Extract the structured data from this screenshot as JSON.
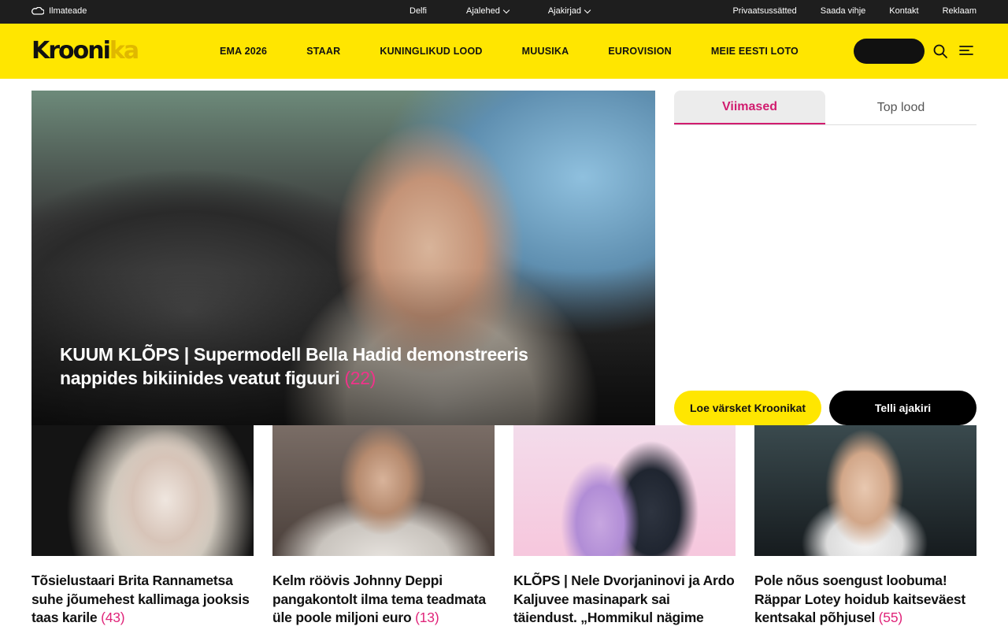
{
  "topbar": {
    "weather_label": "Ilmateade",
    "links_center": [
      {
        "label": "Delfi",
        "dropdown": false
      },
      {
        "label": "Ajalehed",
        "dropdown": true
      },
      {
        "label": "Ajakirjad",
        "dropdown": true
      }
    ],
    "links_right": [
      "Privaatsussätted",
      "Saada vihje",
      "Kontakt",
      "Reklaam"
    ]
  },
  "header": {
    "logo_main": "Kroonika",
    "nav": [
      "EMA 2026",
      "STAAR",
      "KUNINGLIKUD LOOD",
      "MUUSIKA",
      "EUROVISION",
      "MEIE EESTI LOTO"
    ]
  },
  "hero": {
    "title": "KUUM KLÕPS | Supermodell Bella Hadid demonstreeris nappides bikiinides veatut figuuri",
    "comments": "(22)"
  },
  "sidebar": {
    "tabs": [
      "Viimased",
      "Top lood"
    ],
    "active_tab": "Viimased",
    "button_read": "Loe värsket Kroonikat",
    "button_order": "Telli ajakiri"
  },
  "articles": [
    {
      "title": "Tõsielustaari Brita Rannametsa suhe jõumehest kallimaga jooksis taas karile",
      "comments": "(43)"
    },
    {
      "title": "Kelm röövis Johnny Deppi pangakontolt ilma tema teadmata üle poole miljoni euro",
      "comments": "(13)"
    },
    {
      "title": "KLÕPS | Nele Dvorjaninovi ja Ardo Kaljuvee masinapark sai täiendust. „Hommikul nägime",
      "comments": ""
    },
    {
      "title": "Pole nõus soengust loobuma! Räppar Lotey hoidub kaitseväest kentsakal põhjusel",
      "comments": "(55)"
    }
  ],
  "colors": {
    "brand_yellow": "#ffe600",
    "accent_pink": "#d11c6f",
    "topbar_bg": "#1e1e1e"
  }
}
